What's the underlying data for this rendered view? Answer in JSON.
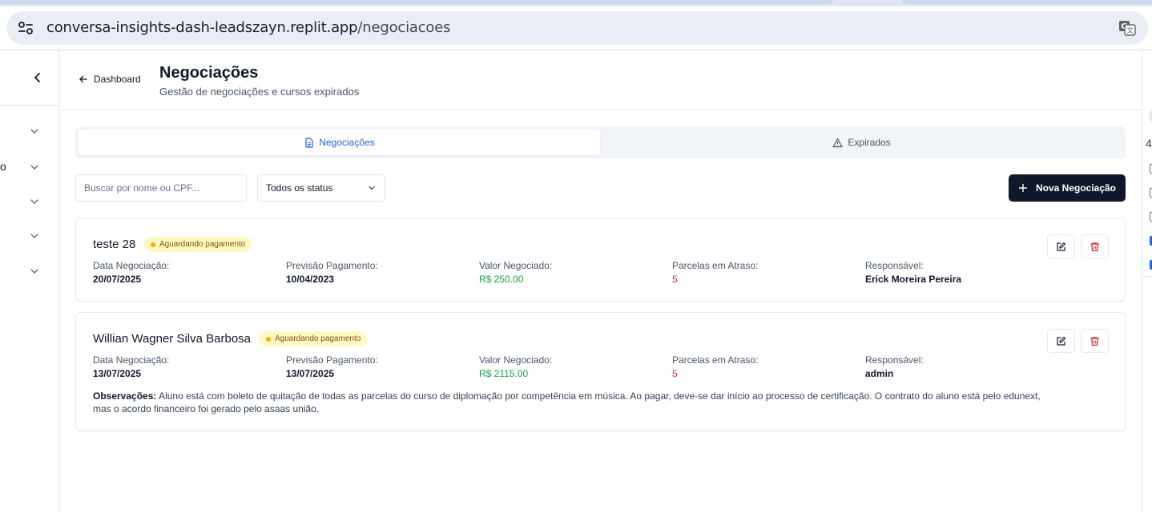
{
  "browser": {
    "url_host": "conversa-insights-dash-leadszayn.replit.app",
    "url_path": "/negociacoes",
    "site_icon": "tune-icon",
    "translate_icon": "translate-icon"
  },
  "sidebar": {
    "collapse_icon": "chevron-left-icon",
    "fragment_label": "o"
  },
  "rightpanel": {
    "fragment_number": "4"
  },
  "header": {
    "back_label": "Dashboard",
    "title": "Negociações",
    "subtitle": "Gestão de negociações e cursos expirados"
  },
  "tabs": [
    {
      "label": "Negociações",
      "icon": "file-text-icon",
      "active": true
    },
    {
      "label": "Expirados",
      "icon": "alert-triangle-icon",
      "active": false
    }
  ],
  "filters": {
    "search_placeholder": "Buscar por nome ou CPF...",
    "search_value": "",
    "status_selected": "Todos os status",
    "new_button_label": "Nova Negociação"
  },
  "field_labels": {
    "data": "Data Negociação:",
    "previsao": "Previsão Pagamento:",
    "valor": "Valor Negociado:",
    "parcelas": "Parcelas em Atraso:",
    "responsavel": "Responsável:"
  },
  "negotiations": [
    {
      "name": "teste 28",
      "status": "Aguardando pagamento",
      "data": "20/07/2025",
      "previsao": "10/04/2023",
      "valor": "R$ 250.00",
      "parcelas": "5",
      "responsavel": "Erick Moreira Pereira"
    },
    {
      "name": "Willian Wagner Silva Barbosa",
      "status": "Aguardando pagamento",
      "data": "13/07/2025",
      "previsao": "13/07/2025",
      "valor": "R$ 2115.00",
      "parcelas": "5",
      "responsavel": "admin",
      "obs_label": "Observações:",
      "obs_text": " Aluno está com boleto de quitação de todas as parcelas do curso de diplomação por competência em música. Ao pagar, deve-se dar início ao processo de certificação. O contrato do aluno está pelo edunext, mas o acordo financeiro foi gerado pelo asaas união."
    }
  ],
  "colors": {
    "accent": "#2563eb",
    "primary_button": "#0f172a",
    "value_green": "#16a34a",
    "value_red": "#dc2626",
    "badge_bg": "#fef9c3"
  }
}
